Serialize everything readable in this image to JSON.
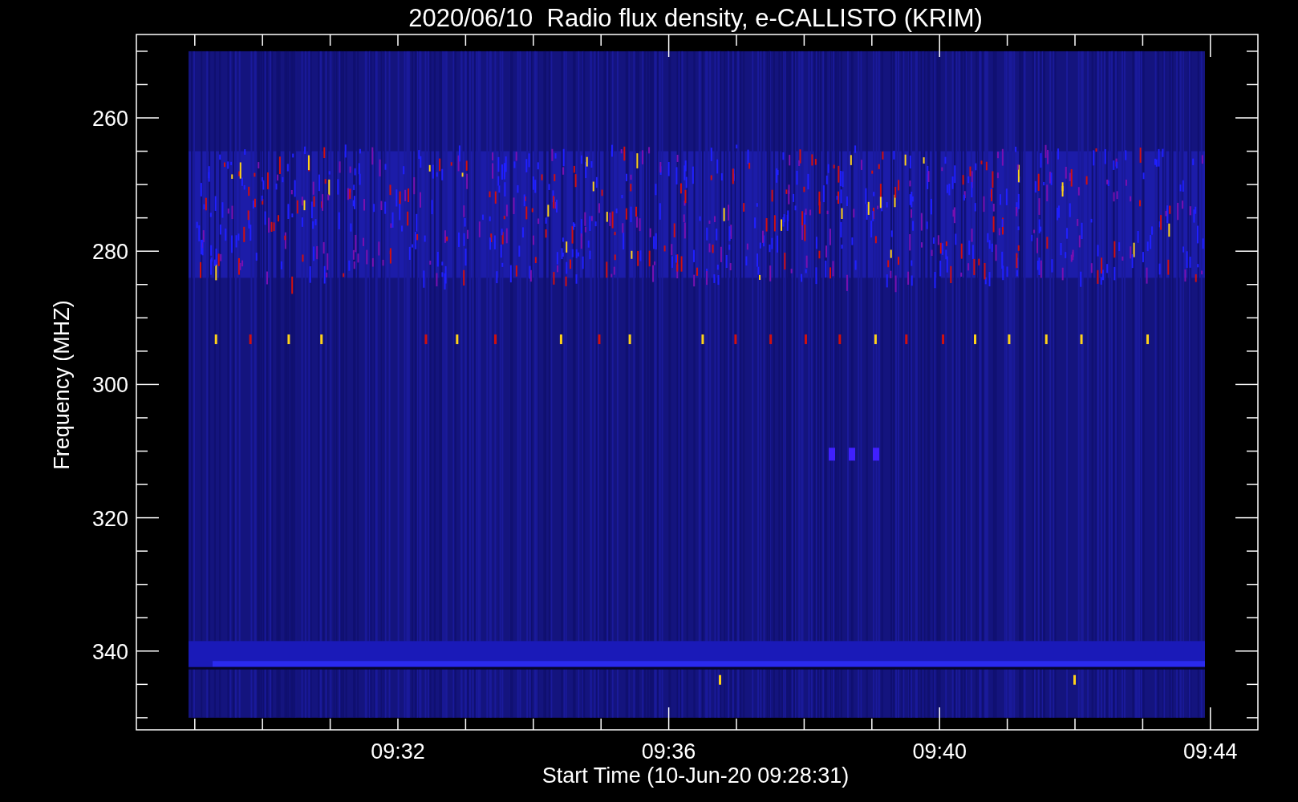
{
  "title": "2020/06/10  Radio flux density, e-CALLISTO (KRIM)",
  "y_axis": {
    "label": "Frequency (MHZ)",
    "ticks": [
      "260",
      "280",
      "300",
      "320",
      "340"
    ]
  },
  "x_axis": {
    "label": "Start Time (10-Jun-20 09:28:31)",
    "ticks": [
      "09:32",
      "09:36",
      "09:40",
      "09:44"
    ]
  }
}
